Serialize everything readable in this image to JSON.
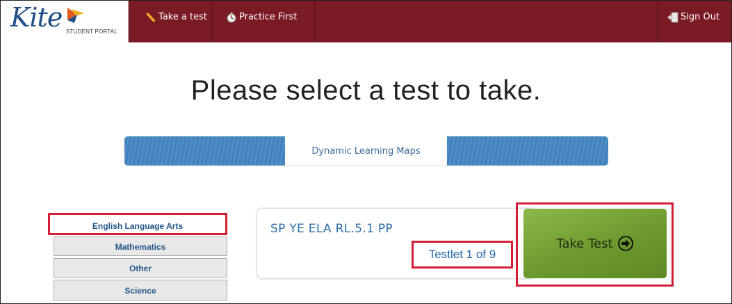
{
  "header": {
    "logo_text": "Kite",
    "logo_subtitle": "STUDENT PORTAL",
    "take_test_label": "Take a test",
    "practice_label": "Practice First",
    "sign_out_label": "Sign Out",
    "colors": {
      "bar": "#7a1a25",
      "logo_blue": "#1d4f86"
    }
  },
  "main": {
    "heading": "Please select a test to take.",
    "program_tab": "Dynamic Learning Maps",
    "subjects": [
      "English Language Arts",
      "Mathematics",
      "Other",
      "Science"
    ],
    "selected_subject": "English Language Arts",
    "test": {
      "name": "SP YE ELA RL.5.1 PP",
      "testlet": "Testlet 1 of 9",
      "button_label": "Take Test"
    }
  },
  "icons": [
    "pencil-icon",
    "stopwatch-icon",
    "sign-out-icon",
    "arrow-right-circle-icon",
    "kite-flag-icon"
  ],
  "highlight_color": "#d31f35"
}
